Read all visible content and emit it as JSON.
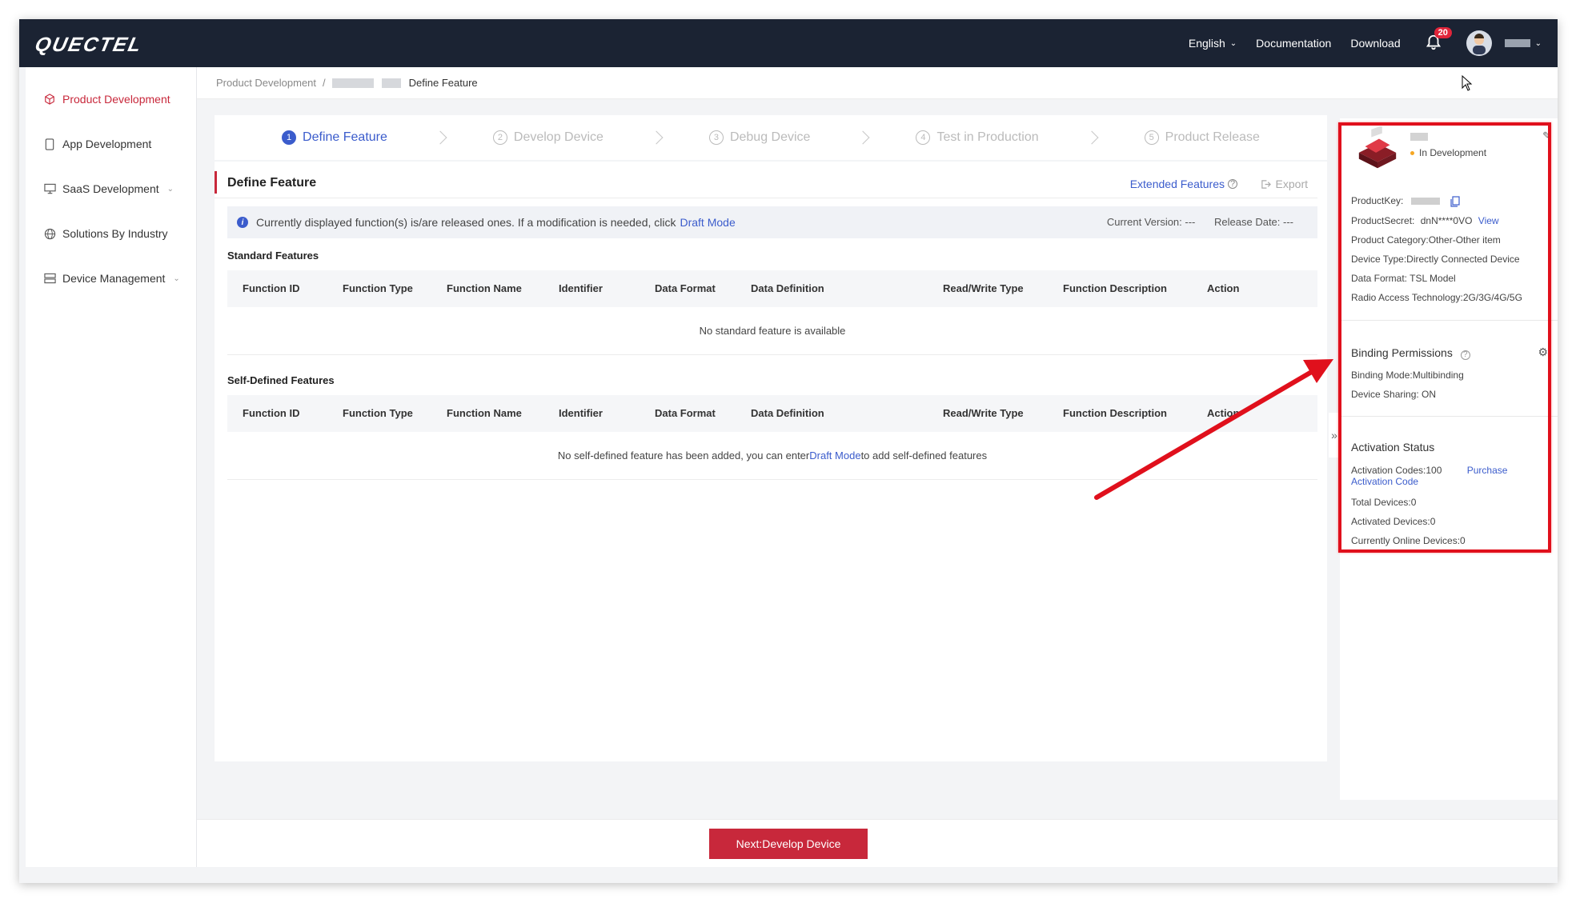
{
  "header": {
    "logo": "QUECTEL",
    "language": "English",
    "documentation": "Documentation",
    "download": "Download",
    "notification_count": "20"
  },
  "sidebar": {
    "items": [
      {
        "label": "Product Development",
        "icon": "cube-icon",
        "active": true
      },
      {
        "label": "App Development",
        "icon": "phone-icon"
      },
      {
        "label": "SaaS Development",
        "icon": "monitor-icon",
        "has_caret": true
      },
      {
        "label": "Solutions By Industry",
        "icon": "globe-icon"
      },
      {
        "label": "Device Management",
        "icon": "server-icon",
        "has_caret": true
      }
    ]
  },
  "breadcrumb": {
    "root": "Product Development",
    "separator": "/",
    "current": "Define Feature"
  },
  "stepper": {
    "steps": [
      {
        "num": "1",
        "label": "Define Feature"
      },
      {
        "num": "2",
        "label": "Develop Device"
      },
      {
        "num": "3",
        "label": "Debug Device"
      },
      {
        "num": "4",
        "label": "Test in Production"
      },
      {
        "num": "5",
        "label": "Product Release"
      }
    ]
  },
  "main": {
    "title": "Define Feature",
    "extended_features": "Extended Features",
    "export": "Export",
    "info_text": "Currently displayed function(s) is/are released ones. If a modification is needed, click",
    "draft_mode": "Draft Mode",
    "current_version": "Current Version: ---",
    "release_date": "Release Date: ---",
    "standard_title": "Standard Features",
    "self_defined_title": "Self-Defined Features",
    "columns": [
      "Function ID",
      "Function Type",
      "Function Name",
      "Identifier",
      "Data Format",
      "Data Definition",
      "Read/Write Type",
      "Function Description",
      "Action"
    ],
    "standard_empty": "No standard feature is available",
    "self_empty_prefix": "No self-defined feature has been added, you can enter",
    "self_empty_link": "Draft Mode",
    "self_empty_suffix": "to add self-defined features"
  },
  "product_panel": {
    "status": "In Development",
    "product_key_label": "ProductKey:",
    "product_secret_label": "ProductSecret:",
    "product_secret_value": "dnN****0VO",
    "view_link": "View",
    "category": "Product Category:Other-Other item",
    "device_type": "Device Type:Directly Connected Device",
    "data_format": "Data Format: TSL Model",
    "radio": "Radio Access Technology:2G/3G/4G/5G",
    "binding_title": "Binding Permissions",
    "binding_mode": "Binding Mode:Multibinding",
    "device_sharing": "Device Sharing: ON",
    "activation_title": "Activation Status",
    "activation_codes": "Activation Codes:100",
    "purchase_link": "Purchase Activation Code",
    "total_devices": "Total Devices:0",
    "activated_devices": "Activated Devices:0",
    "online_devices": "Currently Online Devices:0"
  },
  "footer": {
    "next_button": "Next:Develop Device"
  },
  "colors": {
    "header_bg": "#1b2333",
    "brand_red": "#c8283b",
    "link_blue": "#3b5ccc",
    "highlight_red": "#e0101c"
  }
}
